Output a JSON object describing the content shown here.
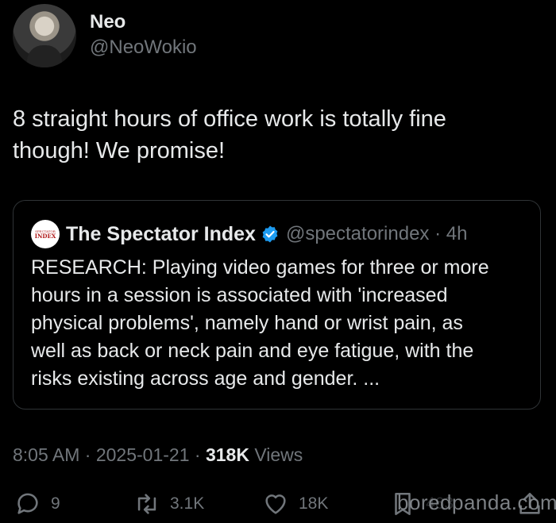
{
  "author": {
    "name": "Neo",
    "handle": "@NeoWokio"
  },
  "tweet": {
    "text_line1": "8 straight hours of office work is totally fine",
    "text_line2": "though! We promise!"
  },
  "quote": {
    "logo_line1": "SPECTATOR",
    "logo_line2": "INDEX",
    "name": "The Spectator Index",
    "handle": "@spectatorindex",
    "time": "4h",
    "body": [
      "RESEARCH: Playing video games for three or more",
      "hours in a session is associated with 'increased",
      "physical problems', namely hand or wrist pain, as",
      "well as back or neck pain and eye fatigue, with the",
      "risks existing across age and gender. ..."
    ]
  },
  "meta": {
    "time": "8:05 AM",
    "date": "2025-01-21",
    "views_count": "318K",
    "views_label": "Views"
  },
  "actions": {
    "replies": "9",
    "reposts": "3.1K",
    "likes": "18K",
    "bookmarks": "463"
  },
  "watermark": "boredpanda.com",
  "colors": {
    "background": "#000000",
    "text": "#e7e9ea",
    "secondary": "#71767b",
    "verified": "#1d9bf0"
  }
}
